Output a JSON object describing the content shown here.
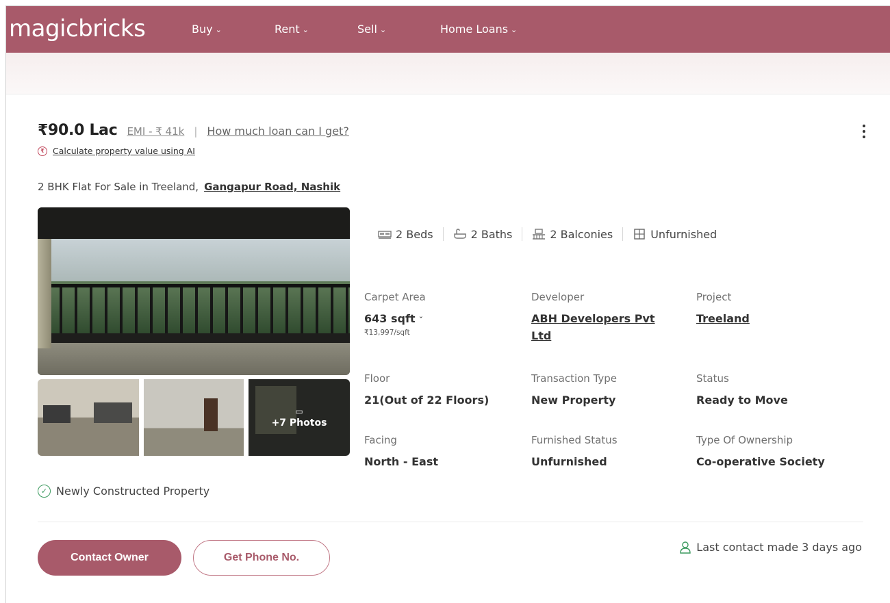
{
  "header": {
    "logo": "magicbricks",
    "nav": [
      {
        "label": "Buy"
      },
      {
        "label": "Rent"
      },
      {
        "label": "Sell"
      },
      {
        "label": "Home Loans"
      }
    ]
  },
  "listing": {
    "price": "₹90.0 Lac",
    "emi": "EMI - ₹ 41k",
    "separator": "|",
    "loan_link": "How much loan can I get?",
    "ai_link": "Calculate property value using AI",
    "title_prefix": "2 BHK Flat For Sale in Treeland,",
    "title_location": "Gangapur Road, Nashik",
    "more_photos": "+7 Photos",
    "amenities": [
      {
        "icon": "bed-icon",
        "label": "2 Beds"
      },
      {
        "icon": "bath-icon",
        "label": "2 Baths"
      },
      {
        "icon": "balcony-icon",
        "label": "2 Balconies"
      },
      {
        "icon": "furnishing-icon",
        "label": "Unfurnished"
      }
    ],
    "details": {
      "carpet_area": {
        "label": "Carpet Area",
        "value": "643 sqft",
        "sub": "₹13,997/sqft"
      },
      "developer": {
        "label": "Developer",
        "value": "ABH Developers Pvt Ltd"
      },
      "project": {
        "label": "Project",
        "value": "Treeland"
      },
      "floor": {
        "label": "Floor",
        "value": "21(Out of 22 Floors)"
      },
      "transaction": {
        "label": "Transaction Type",
        "value": "New Property"
      },
      "status": {
        "label": "Status",
        "value": "Ready to Move"
      },
      "facing": {
        "label": "Facing",
        "value": "North - East"
      },
      "furnished": {
        "label": "Furnished Status",
        "value": "Unfurnished"
      },
      "ownership": {
        "label": "Type Of Ownership",
        "value": "Co-operative Society"
      }
    },
    "newly_constructed": "Newly Constructed Property",
    "contact_owner": "Contact Owner",
    "get_phone": "Get Phone No.",
    "last_contact": "Last contact made 3 days ago"
  },
  "colors": {
    "brand": "#a85a6a",
    "check": "#3c9a5f"
  }
}
